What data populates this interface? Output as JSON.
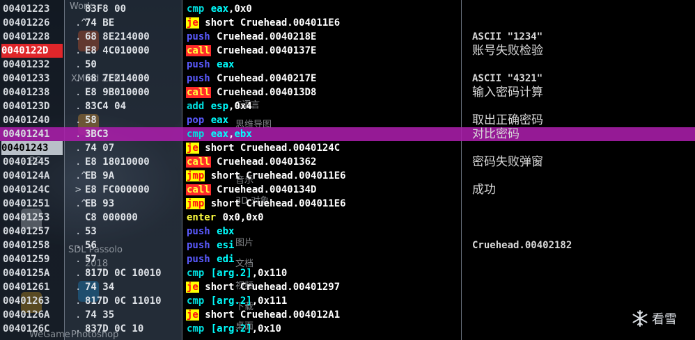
{
  "colors": {
    "breakpoint": "#e0262a",
    "selected_row": "#aa1eaa",
    "call_bg": "#ff2a2a",
    "jump_bg": "#ffff00",
    "register": "#00ffff",
    "push": "#5a5aff"
  },
  "rows": [
    {
      "addr": "00401223",
      "mark": "",
      "hex": "83F8 00",
      "mn": "cmp",
      "cls": "cmp",
      "ops": "eax,0x0",
      "comment": ""
    },
    {
      "addr": "00401226",
      "mark": ".^",
      "hex": "74 BE",
      "mn": "je",
      "cls": "jcc",
      "ops": "short Cruehead.004011E6",
      "comment": ""
    },
    {
      "addr": "00401228",
      "mark": ".",
      "hex": "68 8E214000",
      "mn": "push",
      "cls": "push",
      "ops": "Cruehead.0040218E",
      "comment": "ASCII \"1234\""
    },
    {
      "addr": "0040122D",
      "mark": ".",
      "hex": "E8 4C010000",
      "mn": "call",
      "cls": "call",
      "ops": "Cruehead.0040137E",
      "comment": "账号失败检验",
      "addr_state": "bp"
    },
    {
      "addr": "00401232",
      "mark": ".",
      "hex": "50",
      "mn": "push",
      "cls": "push",
      "ops": "eax",
      "comment": ""
    },
    {
      "addr": "00401233",
      "mark": ".",
      "hex": "68 7E214000",
      "mn": "push",
      "cls": "push",
      "ops": "Cruehead.0040217E",
      "comment": "ASCII \"4321\""
    },
    {
      "addr": "00401238",
      "mark": ".",
      "hex": "E8 9B010000",
      "mn": "call",
      "cls": "call",
      "ops": "Cruehead.004013D8",
      "comment": "输入密码计算"
    },
    {
      "addr": "0040123D",
      "mark": ".",
      "hex": "83C4 04",
      "mn": "add",
      "cls": "add",
      "ops": "esp,0x4",
      "comment": ""
    },
    {
      "addr": "00401240",
      "mark": ".",
      "hex": "58",
      "mn": "pop",
      "cls": "pop",
      "ops": "eax",
      "comment": "取出正确密码"
    },
    {
      "addr": "00401241",
      "mark": ".",
      "hex": "3BC3",
      "mn": "cmp",
      "cls": "cmp",
      "ops": "eax,ebx",
      "comment": "对比密码",
      "selected": true
    },
    {
      "addr": "00401243",
      "mark": ".",
      "hex": "74 07",
      "mn": "je",
      "cls": "jcc",
      "ops": "short Cruehead.0040124C",
      "comment": "",
      "addr_state": "cur"
    },
    {
      "addr": "00401245",
      "mark": ".",
      "hex": "E8 18010000",
      "mn": "call",
      "cls": "call",
      "ops": "Cruehead.00401362",
      "comment": "密码失败弹窗"
    },
    {
      "addr": "0040124A",
      "mark": ".^",
      "hex": "EB 9A",
      "mn": "jmp",
      "cls": "jmp",
      "ops": "short Cruehead.004011E6",
      "comment": ""
    },
    {
      "addr": "0040124C",
      "mark": ">",
      "hex": "E8 FC000000",
      "mn": "call",
      "cls": "call",
      "ops": "Cruehead.0040134D",
      "comment": "成功"
    },
    {
      "addr": "00401251",
      "mark": ".^",
      "hex": "EB 93",
      "mn": "jmp",
      "cls": "jmp",
      "ops": "short Cruehead.004011E6",
      "comment": ""
    },
    {
      "addr": "00401253",
      "mark": "",
      "hex": "C8 000000",
      "mn": "enter",
      "cls": "enter",
      "ops": "0x0,0x0",
      "comment": ""
    },
    {
      "addr": "00401257",
      "mark": ".",
      "hex": "53",
      "mn": "push",
      "cls": "push",
      "ops": "ebx",
      "comment": ""
    },
    {
      "addr": "00401258",
      "mark": ".",
      "hex": "56",
      "mn": "push",
      "cls": "push",
      "ops": "esi",
      "comment": "Cruehead.00402182"
    },
    {
      "addr": "00401259",
      "mark": ".",
      "hex": "57",
      "mn": "push",
      "cls": "push",
      "ops": "edi",
      "comment": ""
    },
    {
      "addr": "0040125A",
      "mark": ".",
      "hex": "817D 0C 10010",
      "mn": "cmp",
      "cls": "cmp",
      "ops": "[arg.2],0x110",
      "comment": ""
    },
    {
      "addr": "00401261",
      "mark": ".",
      "hex": "74 34",
      "mn": "je",
      "cls": "jcc",
      "ops": "short Cruehead.00401297",
      "comment": ""
    },
    {
      "addr": "00401263",
      "mark": ".",
      "hex": "817D 0C 11010",
      "mn": "cmp",
      "cls": "cmp",
      "ops": "[arg.2],0x111",
      "comment": ""
    },
    {
      "addr": "0040126A",
      "mark": ".",
      "hex": "74 35",
      "mn": "je",
      "cls": "jcc",
      "ops": "short Cruehead.004012A1",
      "comment": ""
    },
    {
      "addr": "0040126C",
      "mark": ".",
      "hex": "837D 0C 10",
      "mn": "cmp",
      "cls": "cmp",
      "ops": "[arg.2],0x10",
      "comment": ""
    }
  ],
  "desktop_overlay": [
    "Work",
    "XMind ZEN",
    "PC",
    "SDL Passolo",
    "2018",
    "Photoshop",
    "图片",
    "文档",
    "WeGame",
    "C语言",
    "思维导图",
    "3D 对象",
    "音乐",
    "视频",
    "下载",
    "桌面"
  ],
  "brand": {
    "label": "看雪",
    "icon": "snowflake-icon"
  }
}
